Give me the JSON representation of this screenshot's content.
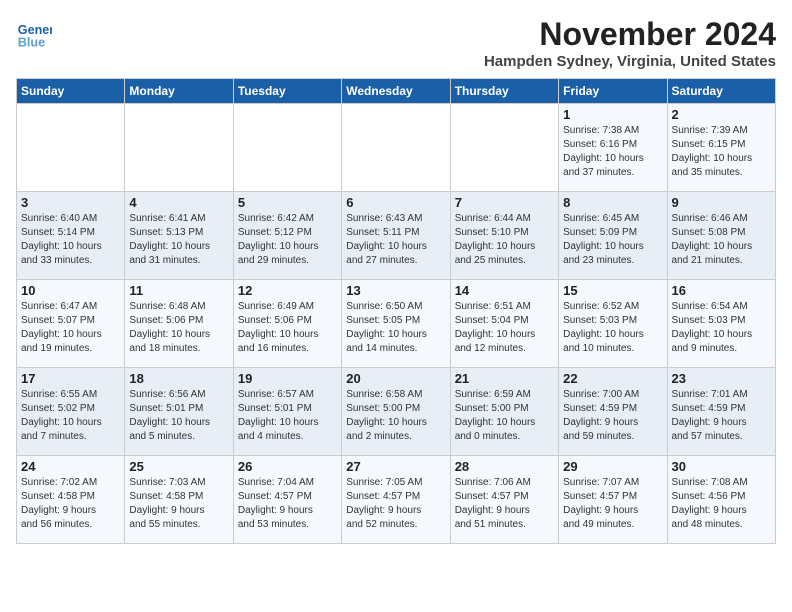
{
  "logo": {
    "name1": "General",
    "name2": "Blue"
  },
  "title": "November 2024",
  "location": "Hampden Sydney, Virginia, United States",
  "days_of_week": [
    "Sunday",
    "Monday",
    "Tuesday",
    "Wednesday",
    "Thursday",
    "Friday",
    "Saturday"
  ],
  "weeks": [
    [
      {
        "day": "",
        "info": ""
      },
      {
        "day": "",
        "info": ""
      },
      {
        "day": "",
        "info": ""
      },
      {
        "day": "",
        "info": ""
      },
      {
        "day": "",
        "info": ""
      },
      {
        "day": "1",
        "info": "Sunrise: 7:38 AM\nSunset: 6:16 PM\nDaylight: 10 hours\nand 37 minutes."
      },
      {
        "day": "2",
        "info": "Sunrise: 7:39 AM\nSunset: 6:15 PM\nDaylight: 10 hours\nand 35 minutes."
      }
    ],
    [
      {
        "day": "3",
        "info": "Sunrise: 6:40 AM\nSunset: 5:14 PM\nDaylight: 10 hours\nand 33 minutes."
      },
      {
        "day": "4",
        "info": "Sunrise: 6:41 AM\nSunset: 5:13 PM\nDaylight: 10 hours\nand 31 minutes."
      },
      {
        "day": "5",
        "info": "Sunrise: 6:42 AM\nSunset: 5:12 PM\nDaylight: 10 hours\nand 29 minutes."
      },
      {
        "day": "6",
        "info": "Sunrise: 6:43 AM\nSunset: 5:11 PM\nDaylight: 10 hours\nand 27 minutes."
      },
      {
        "day": "7",
        "info": "Sunrise: 6:44 AM\nSunset: 5:10 PM\nDaylight: 10 hours\nand 25 minutes."
      },
      {
        "day": "8",
        "info": "Sunrise: 6:45 AM\nSunset: 5:09 PM\nDaylight: 10 hours\nand 23 minutes."
      },
      {
        "day": "9",
        "info": "Sunrise: 6:46 AM\nSunset: 5:08 PM\nDaylight: 10 hours\nand 21 minutes."
      }
    ],
    [
      {
        "day": "10",
        "info": "Sunrise: 6:47 AM\nSunset: 5:07 PM\nDaylight: 10 hours\nand 19 minutes."
      },
      {
        "day": "11",
        "info": "Sunrise: 6:48 AM\nSunset: 5:06 PM\nDaylight: 10 hours\nand 18 minutes."
      },
      {
        "day": "12",
        "info": "Sunrise: 6:49 AM\nSunset: 5:06 PM\nDaylight: 10 hours\nand 16 minutes."
      },
      {
        "day": "13",
        "info": "Sunrise: 6:50 AM\nSunset: 5:05 PM\nDaylight: 10 hours\nand 14 minutes."
      },
      {
        "day": "14",
        "info": "Sunrise: 6:51 AM\nSunset: 5:04 PM\nDaylight: 10 hours\nand 12 minutes."
      },
      {
        "day": "15",
        "info": "Sunrise: 6:52 AM\nSunset: 5:03 PM\nDaylight: 10 hours\nand 10 minutes."
      },
      {
        "day": "16",
        "info": "Sunrise: 6:54 AM\nSunset: 5:03 PM\nDaylight: 10 hours\nand 9 minutes."
      }
    ],
    [
      {
        "day": "17",
        "info": "Sunrise: 6:55 AM\nSunset: 5:02 PM\nDaylight: 10 hours\nand 7 minutes."
      },
      {
        "day": "18",
        "info": "Sunrise: 6:56 AM\nSunset: 5:01 PM\nDaylight: 10 hours\nand 5 minutes."
      },
      {
        "day": "19",
        "info": "Sunrise: 6:57 AM\nSunset: 5:01 PM\nDaylight: 10 hours\nand 4 minutes."
      },
      {
        "day": "20",
        "info": "Sunrise: 6:58 AM\nSunset: 5:00 PM\nDaylight: 10 hours\nand 2 minutes."
      },
      {
        "day": "21",
        "info": "Sunrise: 6:59 AM\nSunset: 5:00 PM\nDaylight: 10 hours\nand 0 minutes."
      },
      {
        "day": "22",
        "info": "Sunrise: 7:00 AM\nSunset: 4:59 PM\nDaylight: 9 hours\nand 59 minutes."
      },
      {
        "day": "23",
        "info": "Sunrise: 7:01 AM\nSunset: 4:59 PM\nDaylight: 9 hours\nand 57 minutes."
      }
    ],
    [
      {
        "day": "24",
        "info": "Sunrise: 7:02 AM\nSunset: 4:58 PM\nDaylight: 9 hours\nand 56 minutes."
      },
      {
        "day": "25",
        "info": "Sunrise: 7:03 AM\nSunset: 4:58 PM\nDaylight: 9 hours\nand 55 minutes."
      },
      {
        "day": "26",
        "info": "Sunrise: 7:04 AM\nSunset: 4:57 PM\nDaylight: 9 hours\nand 53 minutes."
      },
      {
        "day": "27",
        "info": "Sunrise: 7:05 AM\nSunset: 4:57 PM\nDaylight: 9 hours\nand 52 minutes."
      },
      {
        "day": "28",
        "info": "Sunrise: 7:06 AM\nSunset: 4:57 PM\nDaylight: 9 hours\nand 51 minutes."
      },
      {
        "day": "29",
        "info": "Sunrise: 7:07 AM\nSunset: 4:57 PM\nDaylight: 9 hours\nand 49 minutes."
      },
      {
        "day": "30",
        "info": "Sunrise: 7:08 AM\nSunset: 4:56 PM\nDaylight: 9 hours\nand 48 minutes."
      }
    ]
  ]
}
